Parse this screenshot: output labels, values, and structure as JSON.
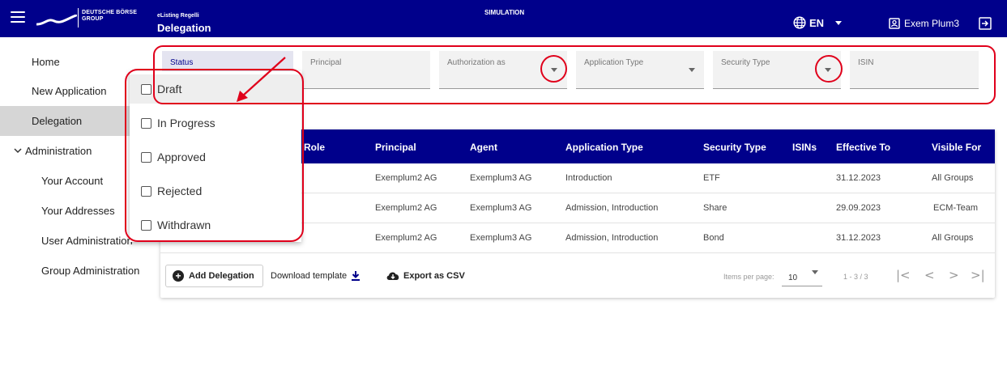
{
  "header": {
    "logo_line1": "DEUTSCHE BÖRSE",
    "logo_line2": "GROUP",
    "app_subtitle": "eListing Regelli",
    "page_title": "Delegation",
    "environment": "SIMULATION",
    "language": "EN",
    "user_name": "Exem Plum3",
    "icons": [
      "menu-icon",
      "globe-icon",
      "user-badge-icon",
      "logout-icon"
    ]
  },
  "sidebar": {
    "items": [
      {
        "label": "Home"
      },
      {
        "label": "New Application"
      },
      {
        "label": "Delegation",
        "active": true
      },
      {
        "label": "Administration",
        "expanded": true
      },
      {
        "label": "Your Account"
      },
      {
        "label": "Your Addresses"
      },
      {
        "label": "User Administration"
      },
      {
        "label": "Group Administration"
      }
    ]
  },
  "filters": [
    {
      "label": "Status"
    },
    {
      "label": "Principal"
    },
    {
      "label": "Authorization as"
    },
    {
      "label": "Application Type"
    },
    {
      "label": "Security Type"
    },
    {
      "label": "ISIN"
    }
  ],
  "status_options": [
    "Draft",
    "In Progress",
    "Approved",
    "Rejected",
    "Withdrawn"
  ],
  "table": {
    "columns": [
      "Role",
      "Principal",
      "Agent",
      "Application Type",
      "Security Type",
      "ISINs",
      "Effective To",
      "Visible For"
    ],
    "rows": [
      {
        "principal": "Exemplum2 AG",
        "agent": "Exemplum3 AG",
        "application_type": "Introduction",
        "security_type": "ETF",
        "effective_to": "31.12.2023",
        "visible_for": "All Groups"
      },
      {
        "principal": "Exemplum2 AG",
        "agent": "Exemplum3 AG",
        "application_type": "Admission, Introduction",
        "security_type": "Share",
        "effective_to": "29.09.2023",
        "visible_for": "ECM-Team"
      },
      {
        "principal": "Exemplum2 AG",
        "agent": "Exemplum3 AG",
        "application_type": "Admission, Introduction",
        "security_type": "Bond",
        "effective_to": "31.12.2023",
        "visible_for": "All Groups"
      }
    ]
  },
  "footer": {
    "add_label": "Add Delegation",
    "download_label": "Download template",
    "export_label": "Export as CSV",
    "items_per_page_label": "Items per page:",
    "items_per_page_value": "10",
    "range": "1 - 3 / 3",
    "pager": {
      "first": "|<",
      "prev": "<",
      "next": ">",
      "last": ">|"
    }
  },
  "colors": {
    "brand": "#00008b",
    "annotation": "#e0001b"
  }
}
